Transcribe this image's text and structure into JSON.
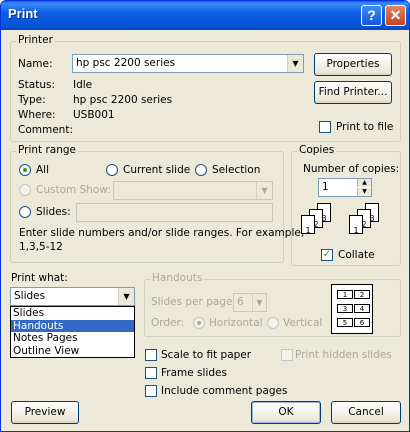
{
  "window": {
    "title": "Print"
  },
  "printer": {
    "legend": "Printer",
    "name_label": "Name:",
    "name_value": "hp psc 2200 series",
    "status_label": "Status:",
    "status_value": "Idle",
    "type_label": "Type:",
    "type_value": "hp psc 2200 series",
    "where_label": "Where:",
    "where_value": "USB001",
    "comment_label": "Comment:",
    "properties_label": "Properties",
    "find_printer_label": "Find Printer...",
    "print_to_file_label": "Print to file"
  },
  "print_range": {
    "legend": "Print range",
    "all_label": "All",
    "current_slide_label": "Current slide",
    "selection_label": "Selection",
    "custom_show_label": "Custom Show:",
    "slides_label": "Slides:",
    "hint": "Enter slide numbers and/or slide ranges. For example,",
    "hint2": "1,3,5-12"
  },
  "copies": {
    "legend": "Copies",
    "number_label": "Number of copies:",
    "number_value": "1",
    "collate_label": "Collate"
  },
  "print_what": {
    "label": "Print what:",
    "selected": "Slides",
    "options": [
      "Slides",
      "Handouts",
      "Notes Pages",
      "Outline View"
    ]
  },
  "handouts": {
    "legend": "Handouts",
    "slides_per_page_label": "Slides per page:",
    "slides_per_page_value": "6",
    "order_label": "Order:",
    "horizontal_label": "Horizontal",
    "vertical_label": "Vertical"
  },
  "options": {
    "scale_label": "Scale to fit paper",
    "frame_label": "Frame slides",
    "comments_label": "Include comment pages",
    "hidden_label": "Print hidden slides"
  },
  "buttons": {
    "preview": "Preview",
    "ok": "OK",
    "cancel": "Cancel"
  },
  "collate_icon": {
    "page_numbers": [
      "1",
      "2",
      "3"
    ]
  },
  "handout_icon": {
    "numbers": [
      "1",
      "2",
      "3",
      "4",
      "5",
      "6"
    ]
  }
}
